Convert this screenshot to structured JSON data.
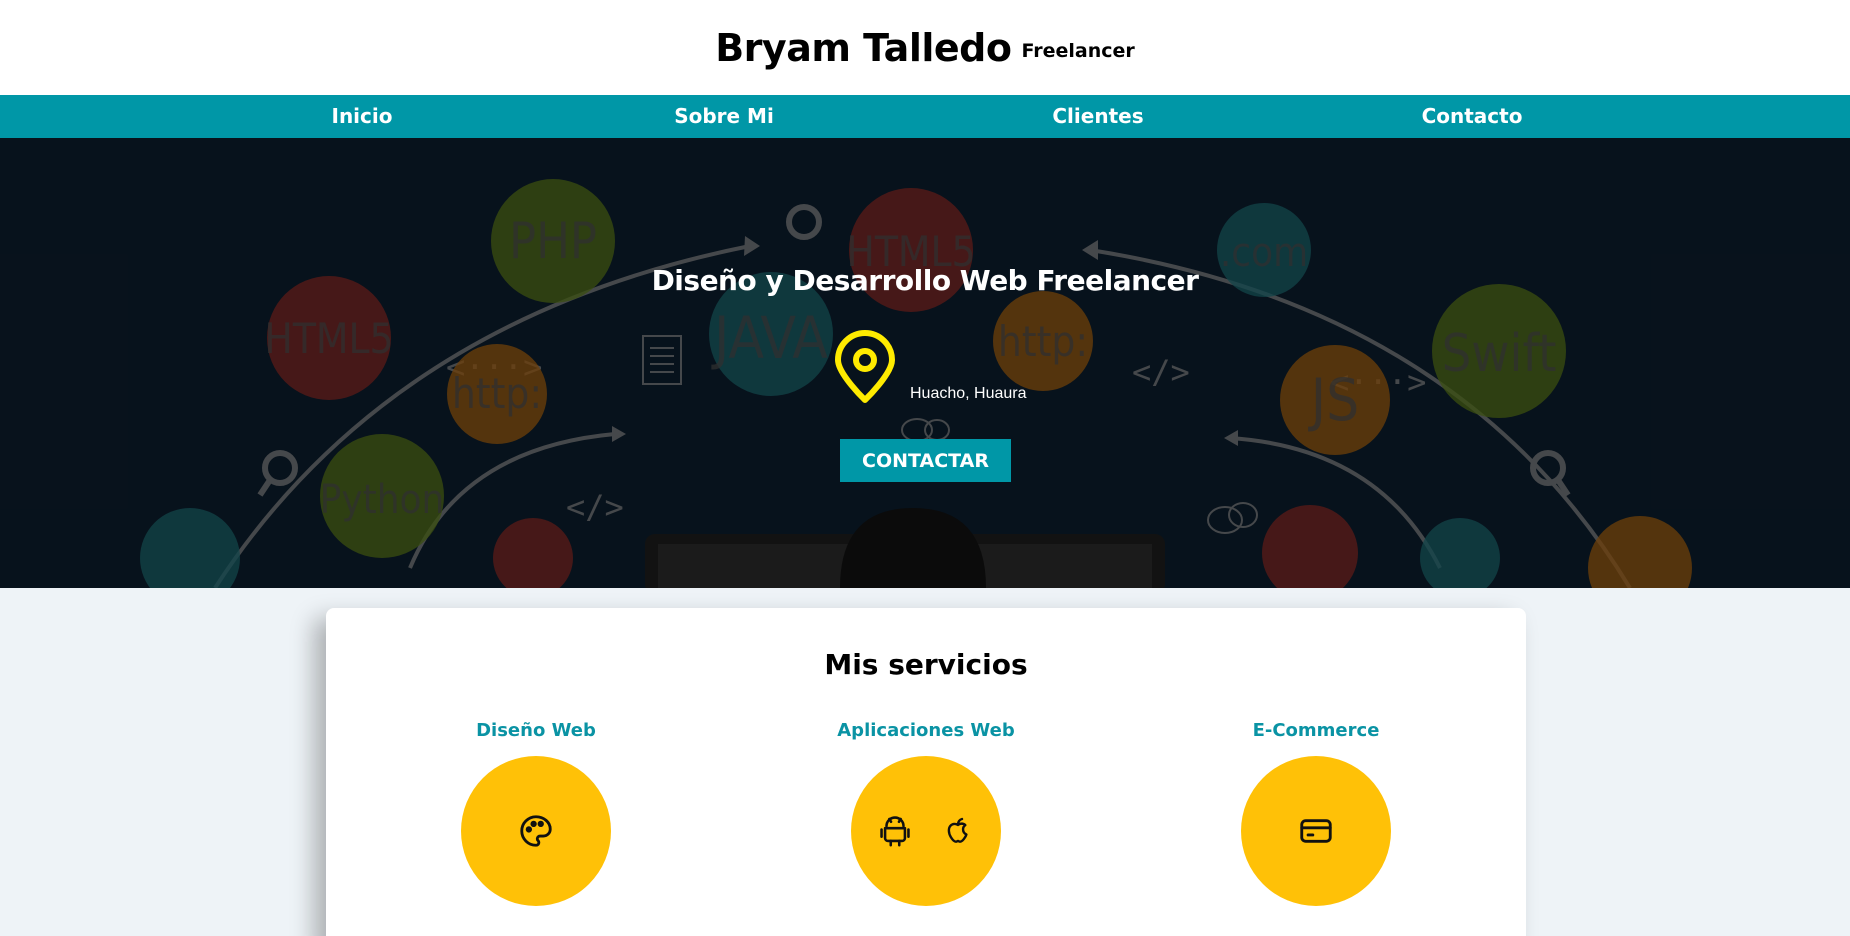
{
  "header": {
    "name": "Bryam Talledo",
    "tagline": "Freelancer"
  },
  "nav": {
    "items": [
      {
        "label": "Inicio"
      },
      {
        "label": "Sobre Mi"
      },
      {
        "label": "Clientes"
      },
      {
        "label": "Contacto"
      }
    ]
  },
  "hero": {
    "title": "Diseño y Desarrollo Web Freelancer",
    "location": "Huacho, Huaura",
    "location_icon": "map-pin-icon",
    "cta_label": "CONTACTAR",
    "background_badges": [
      "PHP",
      "HTML5",
      "HTML5",
      ".com",
      "JAVA",
      "http:",
      "http:",
      "Swift",
      "JS",
      "Python"
    ]
  },
  "services": {
    "title": "Mis servicios",
    "items": [
      {
        "name": "Diseño Web",
        "icons": [
          "palette-icon"
        ]
      },
      {
        "name": "Aplicaciones Web",
        "icons": [
          "android-icon",
          "apple-icon"
        ]
      },
      {
        "name": "E-Commerce",
        "icons": [
          "credit-card-icon"
        ]
      }
    ]
  },
  "colors": {
    "primary": "#0097a7",
    "accent": "#ffc107",
    "pin": "#ffeb00",
    "hero_bg": "#0c1c2b"
  }
}
